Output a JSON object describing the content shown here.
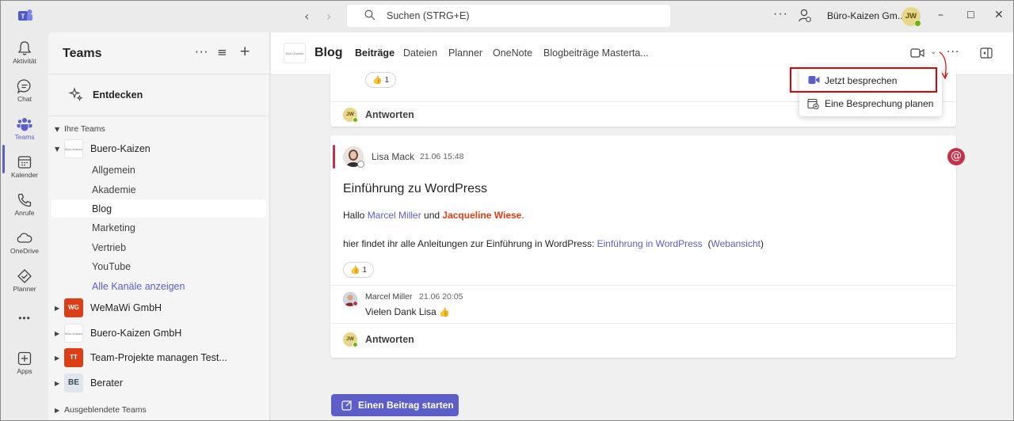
{
  "titlebar": {
    "search_placeholder": "Suchen (STRG+E)",
    "org_name": "Büro-Kaizen Gm...",
    "avatar_initials": "JW"
  },
  "rail": {
    "items": [
      {
        "label": "Aktivität",
        "icon": "bell-icon"
      },
      {
        "label": "Chat",
        "icon": "chat-icon"
      },
      {
        "label": "Teams",
        "icon": "teams-icon"
      },
      {
        "label": "Kalender",
        "icon": "calendar-icon"
      },
      {
        "label": "Anrufe",
        "icon": "phone-icon"
      },
      {
        "label": "OneDrive",
        "icon": "cloud-icon"
      },
      {
        "label": "Planner",
        "icon": "planner-icon"
      },
      {
        "label": "Apps",
        "icon": "add-app-icon"
      }
    ],
    "active": "Teams",
    "more": "•••"
  },
  "teams_panel": {
    "title": "Teams",
    "discover": "Entdecken",
    "section_your_teams": "Ihre Teams",
    "teams": [
      {
        "name": "Buero-Kaizen",
        "logo": "Büro-Kaizen",
        "expanded": true,
        "channels": [
          "Allgemein",
          "Akademie",
          "Blog",
          "Marketing",
          "Vertrieb",
          "YouTube"
        ],
        "selected_channel": "Blog",
        "show_all": "Alle Kanäle anzeigen"
      },
      {
        "name": "WeMaWi GmbH",
        "logo": "WG"
      },
      {
        "name": "Buero-Kaizen GmbH",
        "logo": "Büro-Kaizen"
      },
      {
        "name": "Team-Projekte managen Test...",
        "logo": "TT"
      },
      {
        "name": "Berater",
        "logo": "BE"
      }
    ],
    "section_hidden": "Ausgeblendete Teams"
  },
  "channel_header": {
    "logo": "Büro-Kaizen",
    "title": "Blog",
    "tabs": [
      "Beiträge",
      "Dateien",
      "Planner",
      "OneNote",
      "Blogbeiträge Masterta..."
    ],
    "active_tab": "Beiträge"
  },
  "meet_menu": {
    "items": [
      "Jetzt besprechen",
      "Eine Besprechung planen"
    ],
    "highlighted": "Jetzt besprechen"
  },
  "feed": {
    "top_card": {
      "reaction_count": "1",
      "reply_avatar": "JW",
      "reply_label": "Antworten"
    },
    "post": {
      "author": "Lisa Mack",
      "time": "21.06 15:48",
      "title": "Einführung zu WordPress",
      "greeting_prefix": "Hallo ",
      "mention1": "Marcel Miller",
      "greeting_mid": " und ",
      "mention2": "Jacqueline Wiese",
      "greeting_suffix": ".",
      "body_prefix": "hier findet ihr alle Anleitungen zur Einführung in WordPress: ",
      "body_link": "Einführung in WordPress",
      "body_link2_open": "  (",
      "body_link2": "Webansicht",
      "body_link2_close": ")",
      "reaction_count": "1",
      "reply": {
        "author": "Marcel Miller",
        "time": "21.06 20:05",
        "text": "Vielen Dank Lisa"
      },
      "reply_avatar": "JW",
      "reply_label": "Antworten"
    },
    "start_post": "Einen Beitrag starten"
  },
  "colors": {
    "accent": "#5b5fc7",
    "mention_me": "#dc3e15",
    "highlight_border": "#e00000",
    "at_badge": "#c4314b"
  }
}
